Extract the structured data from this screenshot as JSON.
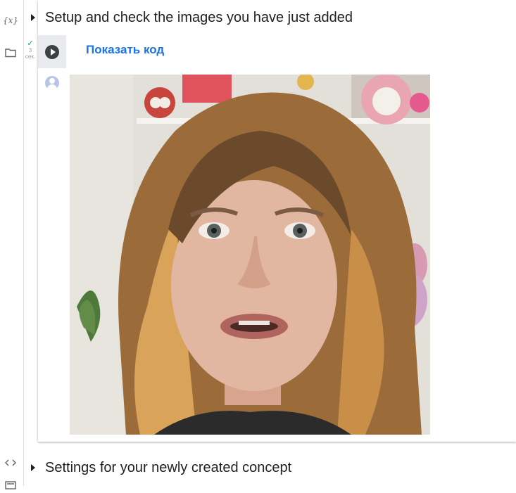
{
  "sidebar": {
    "variables_icon_label": "{x}"
  },
  "cell": {
    "title": "Setup and check the images you have just added",
    "show_code_label": "Показать код",
    "run_time": "3",
    "run_time_unit": "сек."
  },
  "next_section": {
    "title": "Settings for your newly created concept"
  },
  "colors": {
    "accent": "#1a73e8",
    "success": "#0f9d58"
  }
}
